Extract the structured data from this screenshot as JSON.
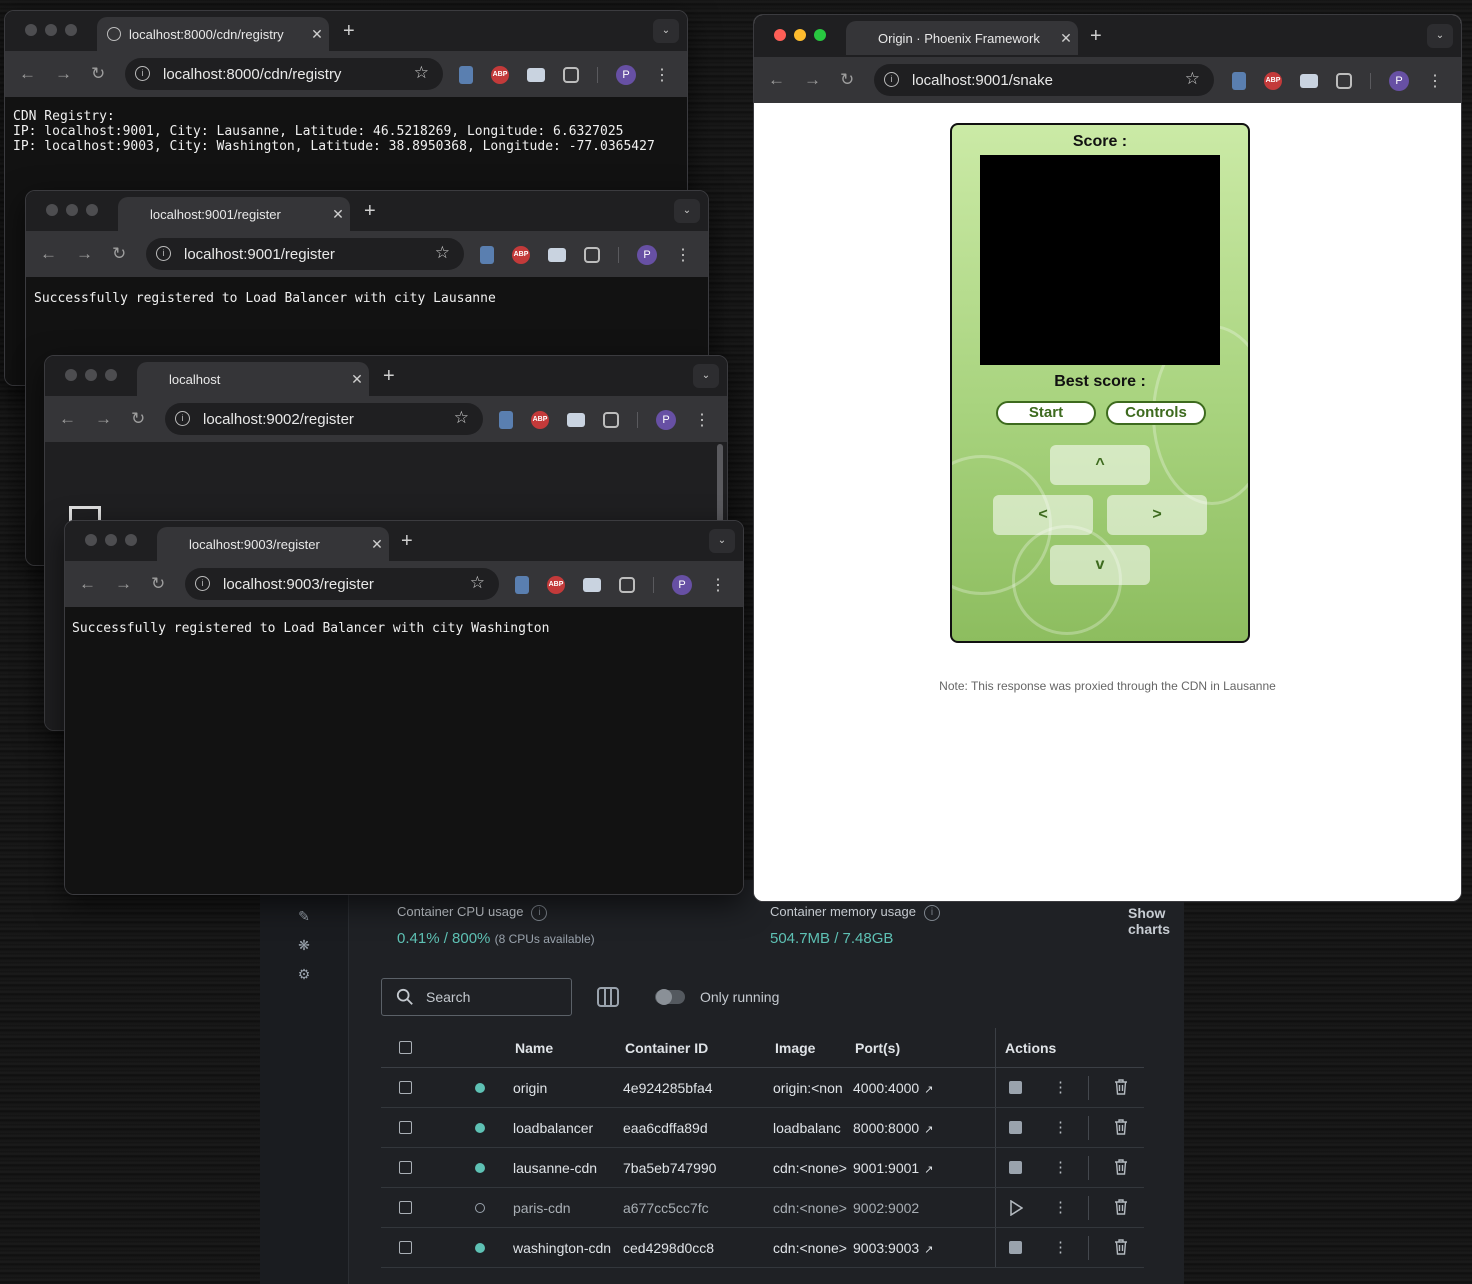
{
  "docker": {
    "cpu_label": "Container CPU usage",
    "cpu_value": "0.41% / 800%",
    "cpu_note": "(8 CPUs available)",
    "mem_label": "Container memory usage",
    "mem_value": "504.7MB / 7.48GB",
    "show_charts": "Show charts",
    "search_placeholder": "Search",
    "only_running": "Only running",
    "columns": {
      "name": "Name",
      "id": "Container ID",
      "image": "Image",
      "ports": "Port(s)",
      "actions": "Actions"
    },
    "rows": [
      {
        "name": "origin",
        "id": "4e924285bfa4",
        "image": "origin:<non",
        "ports": "4000:4000",
        "running": true
      },
      {
        "name": "loadbalancer",
        "id": "eaa6cdffa89d",
        "image": "loadbalanc",
        "ports": "8000:8000",
        "running": true
      },
      {
        "name": "lausanne-cdn",
        "id": "7ba5eb747990",
        "image": "cdn:<none>",
        "ports": "9001:9001",
        "running": true
      },
      {
        "name": "paris-cdn",
        "id": "a677cc5cc7fc",
        "image": "cdn:<none>",
        "ports": "9002:9002",
        "running": false
      },
      {
        "name": "washington-cdn",
        "id": "ced4298d0cc8",
        "image": "cdn:<none>",
        "ports": "9003:9003",
        "running": true
      }
    ]
  },
  "win1": {
    "tab": "localhost:8000/cdn/registry",
    "url": "localhost:8000/cdn/registry",
    "body": "CDN Registry:\nIP: localhost:9001, City: Lausanne, Latitude: 46.5218269, Longitude: 6.6327025\nIP: localhost:9003, City: Washington, Latitude: 38.8950368, Longitude: -77.0365427"
  },
  "win2": {
    "tab": "localhost:9001/register",
    "url": "localhost:9001/register",
    "body": "Successfully registered to Load Balancer with city Lausanne"
  },
  "win3": {
    "tab": "localhost",
    "url": "localhost:9002/register"
  },
  "win4": {
    "tab": "localhost:9003/register",
    "url": "localhost:9003/register",
    "body": "Successfully registered to Load Balancer with city Washington"
  },
  "snake": {
    "tab": "Origin · Phoenix Framework",
    "url": "localhost:9001/snake",
    "score": "Score :",
    "best": "Best score :",
    "start": "Start",
    "controls": "Controls",
    "up": "^",
    "left": "<",
    "right": ">",
    "down": "v",
    "note": "Note: This response was proxied through the CDN in Lausanne"
  },
  "avatar_letter": "P",
  "abp_label": "ABP"
}
